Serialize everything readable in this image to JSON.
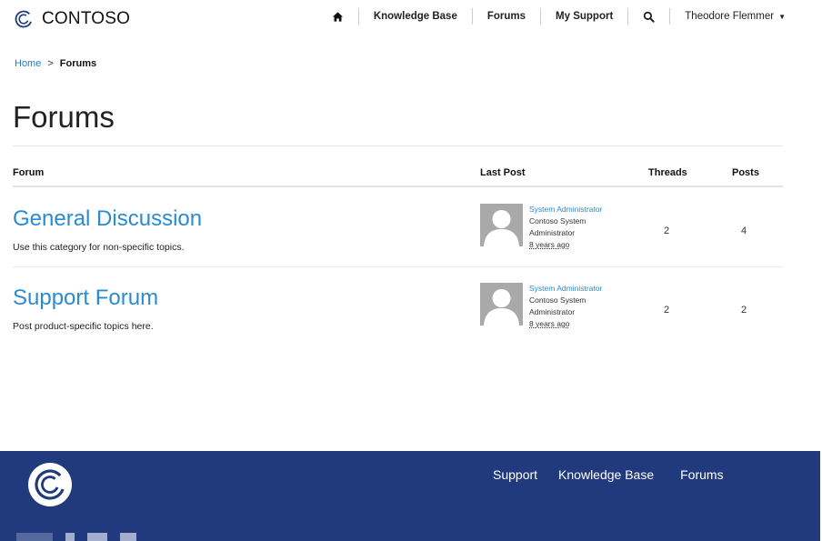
{
  "brand": {
    "name": "CONTOSO"
  },
  "nav": {
    "items": [
      {
        "label": "Knowledge Base"
      },
      {
        "label": "Forums"
      },
      {
        "label": "My Support"
      }
    ],
    "user": "Theodore Flemmer"
  },
  "breadcrumb": {
    "home": "Home",
    "separator": ">",
    "current": "Forums"
  },
  "page": {
    "title": "Forums"
  },
  "table": {
    "headers": {
      "forum": "Forum",
      "last_post": "Last Post",
      "threads": "Threads",
      "posts": "Posts"
    },
    "rows": [
      {
        "name": "General Discussion",
        "description": "Use this category for non-specific topics.",
        "last_post": {
          "author": "System Administrator",
          "org": "Contoso System Administrator",
          "when": "8 years ago"
        },
        "threads": "2",
        "posts": "4"
      },
      {
        "name": "Support Forum",
        "description": "Post product-specific topics here.",
        "last_post": {
          "author": "System Administrator",
          "org": "Contoso System Administrator",
          "when": "8 years ago"
        },
        "threads": "2",
        "posts": "2"
      }
    ]
  },
  "footer": {
    "links": [
      {
        "label": "Support"
      },
      {
        "label": "Knowledge Base"
      },
      {
        "label": "Forums"
      }
    ]
  },
  "colors": {
    "accent": "#2b8bd0",
    "footer_bg": "#213a7e",
    "avatar": "#a9a9a9"
  },
  "icons": [
    "contoso-logo-icon",
    "home-icon",
    "search-icon",
    "caret-down-icon",
    "avatar-icon"
  ]
}
